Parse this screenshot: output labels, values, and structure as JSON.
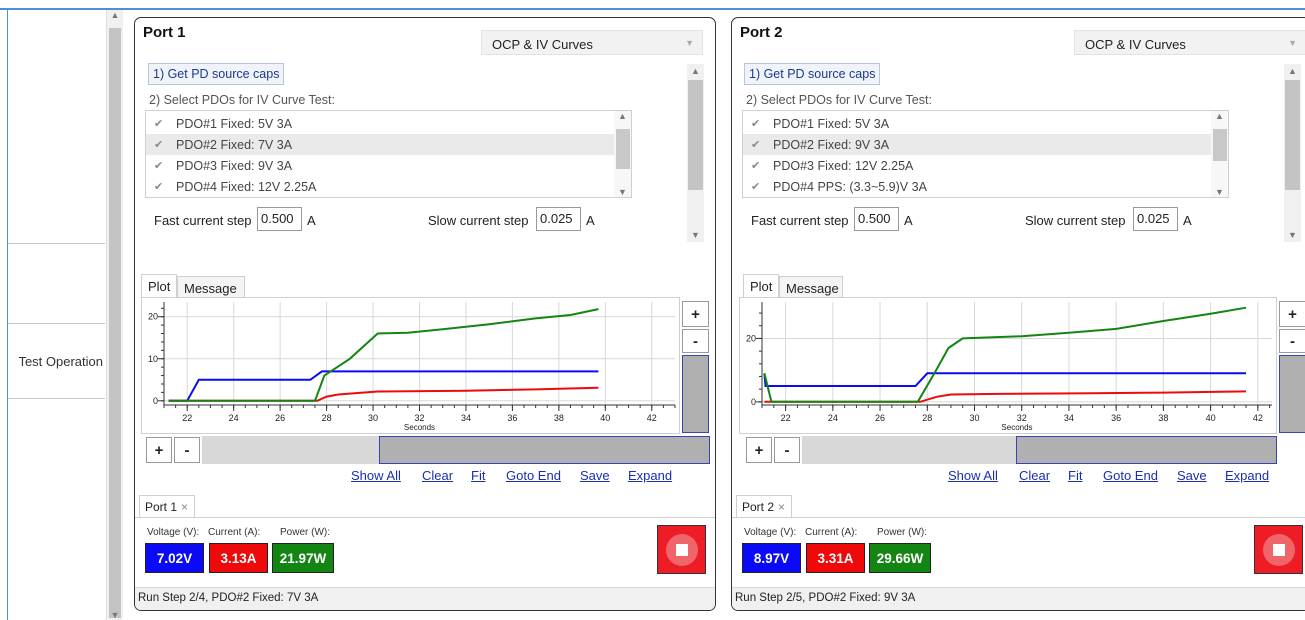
{
  "nav": {
    "test_operation_label": "Test Operation"
  },
  "colors": {
    "voltage": "#0a0af5",
    "current": "#ee0a0a",
    "power": "#138513",
    "stop": "#ee1c25"
  },
  "ports": [
    {
      "title": "Port 1",
      "mode_select": "OCP & IV Curves",
      "get_caps_button": "1) Get PD source caps",
      "select_pdos_label": "2) Select PDOs for IV Curve Test:",
      "pdos": [
        {
          "label": "PDO#1 Fixed: 5V 3A",
          "checked": true,
          "selected": false
        },
        {
          "label": "PDO#2 Fixed: 7V 3A",
          "checked": true,
          "selected": true
        },
        {
          "label": "PDO#3 Fixed: 9V 3A",
          "checked": true,
          "selected": false
        },
        {
          "label": "PDO#4 Fixed: 12V 2.25A",
          "checked": true,
          "selected": false
        }
      ],
      "fast_step_label": "Fast current step",
      "fast_step_value": "0.500",
      "slow_step_label": "Slow current step",
      "slow_step_value": "0.025",
      "unit_a": "A",
      "tabs": [
        "Plot",
        "Message"
      ],
      "zoom_in": "+",
      "zoom_out": "-",
      "links": [
        "Show All",
        "Clear",
        "Fit",
        "Goto End",
        "Save",
        "Expand"
      ],
      "session_tab": "Port 1",
      "close_glyph": "×",
      "voltage_label": "Voltage (V):",
      "current_label": "Current (A):",
      "power_label": "Power (W):",
      "voltage_value": "7.02V",
      "current_value": "3.13A",
      "power_value": "21.97W",
      "status": "Run Step 2/4, PDO#2 Fixed: 7V 3A",
      "chart_data": {
        "type": "line",
        "xlabel": "Seconds",
        "xlim": [
          21,
          43
        ],
        "ylim": [
          -1,
          23.5
        ],
        "x_ticks": [
          22,
          24,
          26,
          28,
          30,
          32,
          34,
          36,
          38,
          40,
          42
        ],
        "y_ticks": [
          0,
          10,
          20
        ],
        "grid": true,
        "series": [
          {
            "color": "#0a0af5",
            "points": [
              [
                21.2,
                0
              ],
              [
                22.0,
                0
              ],
              [
                22.5,
                5
              ],
              [
                27.3,
                5
              ],
              [
                27.8,
                7
              ],
              [
                39.7,
                7
              ]
            ]
          },
          {
            "color": "#ee0a0a",
            "points": [
              [
                21.2,
                0
              ],
              [
                27.6,
                0
              ],
              [
                28.0,
                1
              ],
              [
                28.5,
                1.5
              ],
              [
                30.2,
                2.2
              ],
              [
                34,
                2.4
              ],
              [
                37,
                2.7
              ],
              [
                39.7,
                3.1
              ]
            ]
          },
          {
            "color": "#138513",
            "points": [
              [
                21.2,
                0
              ],
              [
                27.5,
                0
              ],
              [
                27.9,
                6
              ],
              [
                29,
                10
              ],
              [
                30.2,
                16
              ],
              [
                31.5,
                16.2
              ],
              [
                33,
                17
              ],
              [
                35,
                18.2
              ],
              [
                37,
                19.6
              ],
              [
                38.5,
                20.4
              ],
              [
                39.7,
                21.8
              ]
            ]
          }
        ]
      }
    },
    {
      "title": "Port 2",
      "mode_select": "OCP & IV Curves",
      "get_caps_button": "1) Get PD source caps",
      "select_pdos_label": "2) Select PDOs for IV Curve Test:",
      "pdos": [
        {
          "label": "PDO#1 Fixed: 5V 3A",
          "checked": true,
          "selected": false
        },
        {
          "label": "PDO#2 Fixed: 9V 3A",
          "checked": true,
          "selected": true
        },
        {
          "label": "PDO#3 Fixed: 12V 2.25A",
          "checked": true,
          "selected": false
        },
        {
          "label": "PDO#4 PPS: (3.3~5.9)V 3A",
          "checked": true,
          "selected": false
        }
      ],
      "fast_step_label": "Fast current step",
      "fast_step_value": "0.500",
      "slow_step_label": "Slow current step",
      "slow_step_value": "0.025",
      "unit_a": "A",
      "tabs": [
        "Plot",
        "Message"
      ],
      "zoom_in": "+",
      "zoom_out": "-",
      "links": [
        "Show All",
        "Clear",
        "Fit",
        "Goto End",
        "Save",
        "Expand"
      ],
      "session_tab": "Port 2",
      "close_glyph": "×",
      "voltage_label": "Voltage (V):",
      "current_label": "Current (A):",
      "power_label": "Power (W):",
      "voltage_value": "8.97V",
      "current_value": "3.31A",
      "power_value": "29.66W",
      "status": "Run Step 2/5, PDO#2 Fixed: 9V 3A",
      "chart_data": {
        "type": "line",
        "xlabel": "Seconds",
        "xlim": [
          21,
          42.6
        ],
        "ylim": [
          -1,
          31.5
        ],
        "x_ticks": [
          22,
          24,
          26,
          28,
          30,
          32,
          34,
          36,
          38,
          40,
          42
        ],
        "y_ticks": [
          0,
          20
        ],
        "grid": true,
        "series": [
          {
            "color": "#0a0af5",
            "points": [
              [
                21.1,
                9
              ],
              [
                21.15,
                5
              ],
              [
                27.5,
                5
              ],
              [
                28.0,
                9
              ],
              [
                41.5,
                9
              ]
            ]
          },
          {
            "color": "#ee0a0a",
            "points": [
              [
                21.1,
                0
              ],
              [
                27.7,
                0
              ],
              [
                28.4,
                1.6
              ],
              [
                29,
                2.3
              ],
              [
                31,
                2.5
              ],
              [
                35,
                2.7
              ],
              [
                38,
                2.9
              ],
              [
                41.5,
                3.3
              ]
            ]
          },
          {
            "color": "#138513",
            "points": [
              [
                21.1,
                9
              ],
              [
                21.4,
                0
              ],
              [
                27.6,
                0
              ],
              [
                28.3,
                9
              ],
              [
                28.9,
                17
              ],
              [
                29.5,
                20
              ],
              [
                30.5,
                20.3
              ],
              [
                32,
                20.7
              ],
              [
                34,
                21.8
              ],
              [
                36,
                23
              ],
              [
                38,
                25.5
              ],
              [
                40,
                27.8
              ],
              [
                41.5,
                29.7
              ]
            ]
          }
        ]
      }
    }
  ]
}
